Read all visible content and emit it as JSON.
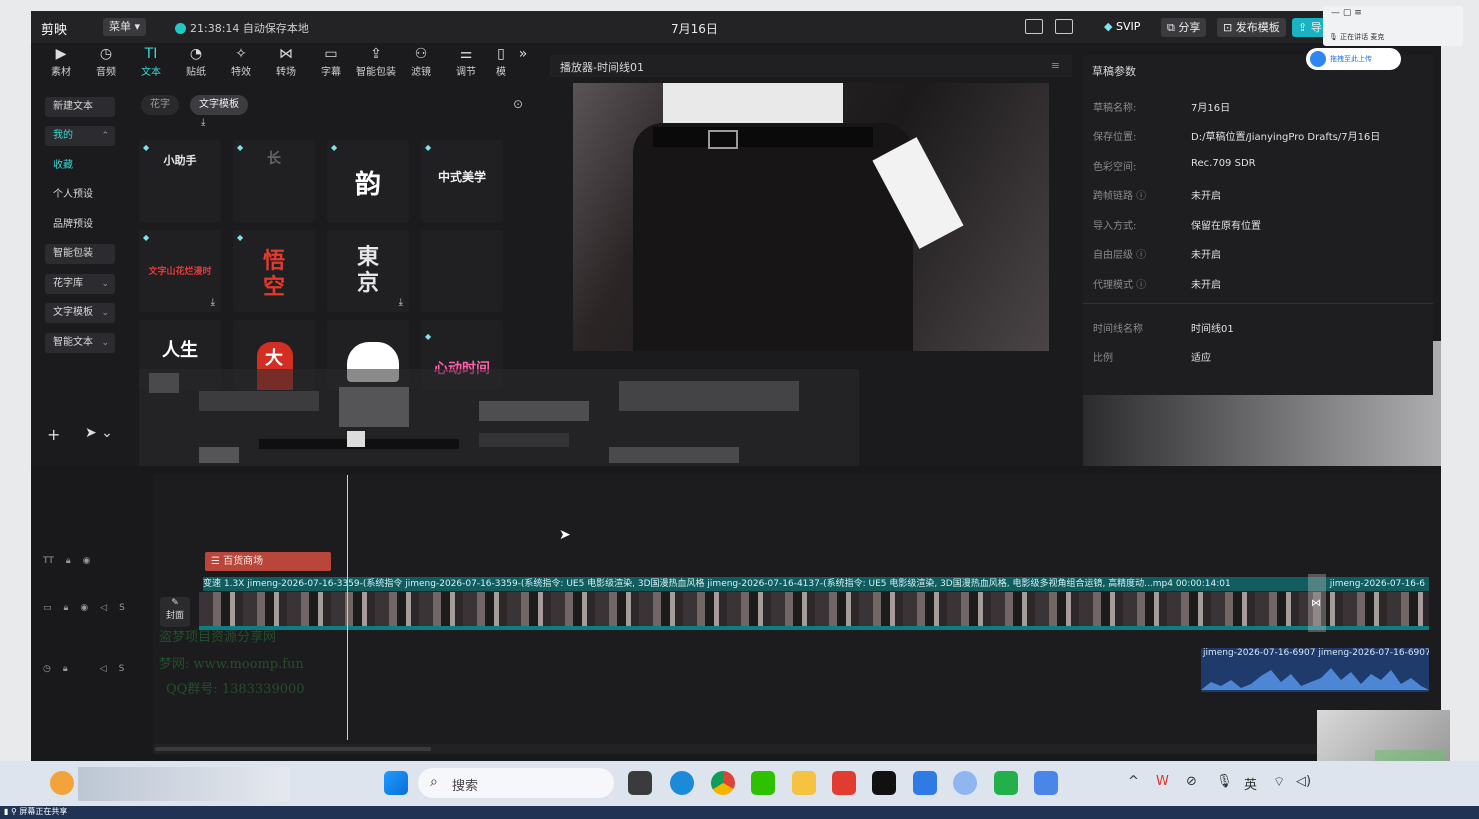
{
  "titlebar": {
    "logo": "剪映",
    "menu": "菜单",
    "autosave": "21:38:14 自动保存本地",
    "date": "7月16日",
    "svip": "SVIP",
    "share": "分享",
    "publish_template": "发布模板",
    "export_partial": "导"
  },
  "overlay_panel": {
    "speaking": "正在讲话",
    "mute": "麦克",
    "upload": "拖拽至此上传"
  },
  "toolbar": {
    "items": [
      {
        "label": "素材",
        "icon": "media-icon"
      },
      {
        "label": "音频",
        "icon": "audio-icon"
      },
      {
        "label": "文本",
        "icon": "text-icon"
      },
      {
        "label": "贴纸",
        "icon": "sticker-icon"
      },
      {
        "label": "特效",
        "icon": "effects-icon"
      },
      {
        "label": "转场",
        "icon": "transition-icon"
      },
      {
        "label": "字幕",
        "icon": "subtitle-icon"
      },
      {
        "label": "智能包装",
        "icon": "smart-pack-icon"
      },
      {
        "label": "滤镜",
        "icon": "filter-icon"
      },
      {
        "label": "调节",
        "icon": "adjust-icon"
      },
      {
        "label": "模",
        "icon": "template-icon"
      }
    ],
    "more": "»"
  },
  "leftnav": {
    "items": [
      {
        "label": "新建文本",
        "style": "box"
      },
      {
        "label": "我的",
        "style": "sel",
        "chev": "⌃"
      },
      {
        "label": "收藏",
        "style": "cyan"
      },
      {
        "label": "个人预设",
        "style": "plain"
      },
      {
        "label": "品牌预设",
        "style": "plain"
      },
      {
        "label": "智能包装",
        "style": "box"
      },
      {
        "label": "花字库",
        "style": "box",
        "chev": "⌄"
      },
      {
        "label": "文字模板",
        "style": "box",
        "chev": "⌄"
      },
      {
        "label": "智能文本",
        "style": "box",
        "chev": "⌄"
      }
    ]
  },
  "text_panel": {
    "tabs": [
      "花字",
      "文字模板"
    ],
    "tiles": [
      {
        "art": "小助手",
        "color": "#e8e8e8"
      },
      {
        "art": "长",
        "color": "#666666"
      },
      {
        "art": "韵",
        "color": "#ffffff"
      },
      {
        "art": "中式美学",
        "color": "#f0f0f0"
      },
      {
        "art": "文字山花烂漫时",
        "color": "#e23b3b"
      },
      {
        "art": "悟空",
        "color": "#e33a2c"
      },
      {
        "art": "東京",
        "color": "#e6e6e6"
      },
      {
        "art": "",
        "color": "#999999"
      },
      {
        "art": "人生",
        "color": "#ffffff"
      },
      {
        "art": "大",
        "color": "#e33a2c"
      },
      {
        "art": "",
        "color": "#ffffff"
      },
      {
        "art": "心动时间",
        "color": "#ff5fa8"
      }
    ]
  },
  "player": {
    "title": "播放器-时间线01"
  },
  "props": {
    "title": "草稿参数",
    "rows": [
      {
        "key": "草稿名称:",
        "value": "7月16日"
      },
      {
        "key": "保存位置:",
        "value": "D:/草稿位置/JianyingPro Drafts/7月16日"
      },
      {
        "key": "色彩空间:",
        "value": "Rec.709 SDR"
      },
      {
        "key": "跨帧链路 ⓘ",
        "value": "未开启"
      },
      {
        "key": "导入方式:",
        "value": "保留在原有位置"
      },
      {
        "key": "自由层级 ⓘ",
        "value": "未开启"
      },
      {
        "key": "代理模式 ⓘ",
        "value": "未开启"
      },
      {
        "key": "时间线名称",
        "value": "时间线01"
      },
      {
        "key": "比例",
        "value": "适应"
      }
    ]
  },
  "timeline": {
    "text_clip": "百货商场",
    "cover": "封面",
    "video_bar": "变速 1.3X  jimeng-2026-07-16-3359-(系统指令  jimeng-2026-07-16-3359-(系统指令: UE5 电影级渲染, 3D国漫热血风格  jimeng-2026-07-16-4137-(系统指令: UE5 电影级渲染, 3D国漫热血风格, 电影级多视角组合运镜, 高精度动...mp4  00:00:14:01",
    "video_tail": "jimeng-2026-07-16-6",
    "audio_label_1": "jimeng-2026-07-16-6907",
    "audio_label_2": "jimeng-2026-07-16-6907",
    "watermark_1": "盗梦项目资源分享网",
    "watermark_2": "梦网: www.moomp.fun",
    "watermark_3": "QQ群号: 1383339000"
  },
  "taskbar": {
    "search": "搜索",
    "tray_chevron": "^",
    "ime": "英",
    "screen_share": "屏幕正在共享"
  }
}
